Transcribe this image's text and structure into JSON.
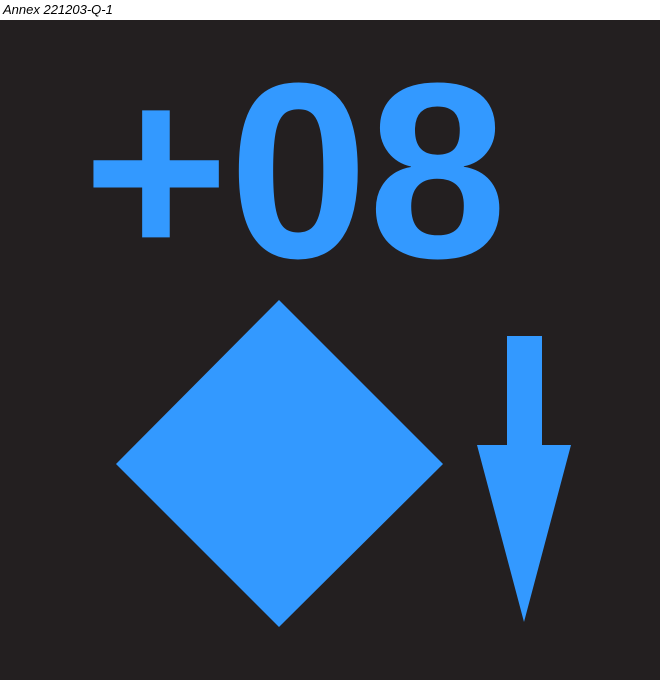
{
  "annex": {
    "caption": "Annex 221203-Q-1"
  },
  "display": {
    "background_color": "#231f20",
    "symbol_color": "#3399ff",
    "value_text": "+08",
    "symbols": {
      "diamond": "diamond-symbol",
      "arrow": "down-arrow-icon"
    }
  }
}
